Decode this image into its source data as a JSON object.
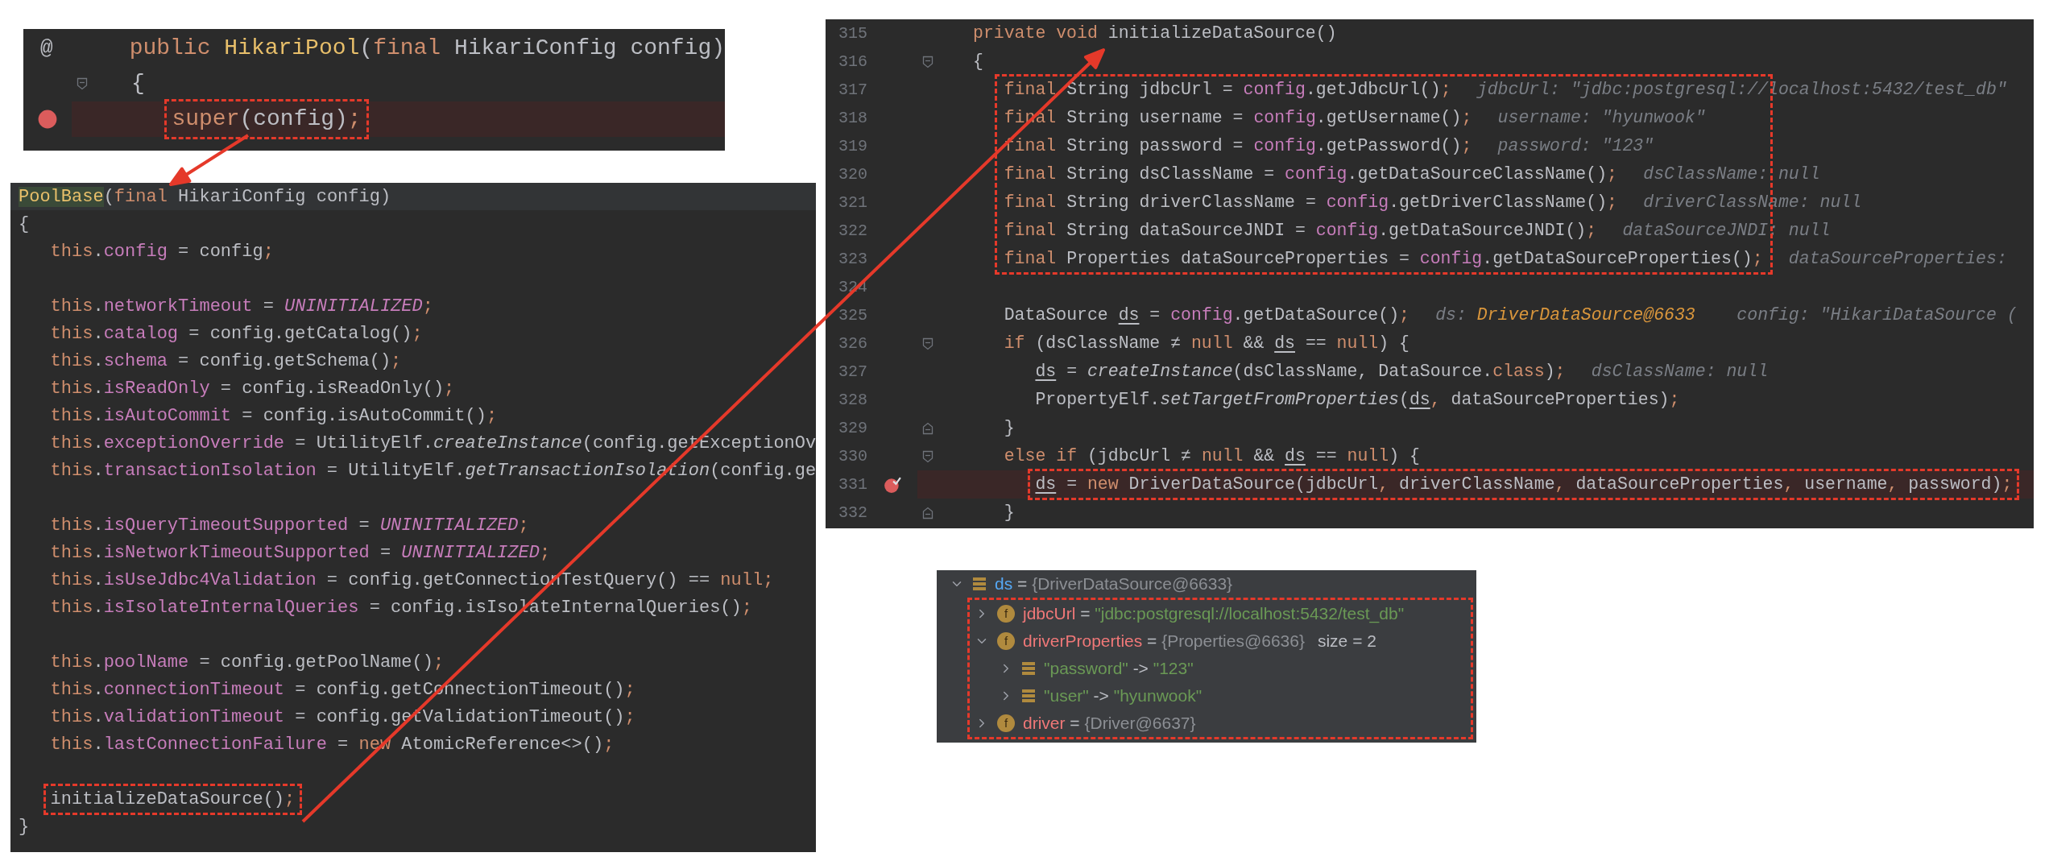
{
  "constructor_snippet": {
    "lines": [
      {
        "kind": "code",
        "gutter_mark": "@",
        "tokens": [
          {
            "kind": "keyword",
            "text": "public "
          },
          {
            "kind": "declaration",
            "text": "HikariPool"
          },
          {
            "kind": "plain",
            "text": "("
          },
          {
            "kind": "keyword",
            "text": "final"
          },
          {
            "kind": "plain",
            "text": " HikariConfig config)"
          }
        ]
      },
      {
        "kind": "code",
        "fold_start": true,
        "tokens": [
          {
            "kind": "plain",
            "text": "{"
          }
        ]
      },
      {
        "kind": "code",
        "breakpoint": true,
        "verified": false,
        "boxed": true,
        "tokens": [
          {
            "kind": "keyword",
            "text": "   super"
          },
          {
            "kind": "plain",
            "text": "(config)"
          },
          {
            "kind": "keyword",
            "text": ";"
          }
        ]
      }
    ]
  },
  "pool_base_snippet": {
    "lines": [
      {
        "kind": "code",
        "current": true,
        "tokens": [
          {
            "kind": "match",
            "text": "PoolBase"
          },
          {
            "kind": "plain",
            "text": "("
          },
          {
            "kind": "keyword",
            "text": "final"
          },
          {
            "kind": "plain",
            "text": " HikariConfig config)"
          }
        ]
      },
      {
        "kind": "code",
        "tokens": [
          {
            "kind": "plain",
            "text": "{"
          }
        ]
      },
      {
        "kind": "code",
        "tokens": [
          {
            "kind": "keyword",
            "text": "   this"
          },
          {
            "kind": "plain",
            "text": "."
          },
          {
            "kind": "field",
            "text": "config"
          },
          {
            "kind": "plain",
            "text": " = config"
          },
          {
            "kind": "keyword",
            "text": ";"
          }
        ]
      },
      {
        "kind": "blank"
      },
      {
        "kind": "code",
        "tokens": [
          {
            "kind": "keyword",
            "text": "   this"
          },
          {
            "kind": "plain",
            "text": "."
          },
          {
            "kind": "field",
            "text": "networkTimeout"
          },
          {
            "kind": "plain",
            "text": " = "
          },
          {
            "kind": "constant",
            "text": "UNINITIALIZED"
          },
          {
            "kind": "keyword",
            "text": ";"
          }
        ]
      },
      {
        "kind": "code",
        "tokens": [
          {
            "kind": "keyword",
            "text": "   this"
          },
          {
            "kind": "plain",
            "text": "."
          },
          {
            "kind": "field",
            "text": "catalog"
          },
          {
            "kind": "plain",
            "text": " = config.getCatalog()"
          },
          {
            "kind": "keyword",
            "text": ";"
          }
        ]
      },
      {
        "kind": "code",
        "tokens": [
          {
            "kind": "keyword",
            "text": "   this"
          },
          {
            "kind": "plain",
            "text": "."
          },
          {
            "kind": "field",
            "text": "schema"
          },
          {
            "kind": "plain",
            "text": " = config.getSchema()"
          },
          {
            "kind": "keyword",
            "text": ";"
          }
        ]
      },
      {
        "kind": "code",
        "tokens": [
          {
            "kind": "keyword",
            "text": "   this"
          },
          {
            "kind": "plain",
            "text": "."
          },
          {
            "kind": "field",
            "text": "isReadOnly"
          },
          {
            "kind": "plain",
            "text": " = config.isReadOnly()"
          },
          {
            "kind": "keyword",
            "text": ";"
          }
        ]
      },
      {
        "kind": "code",
        "tokens": [
          {
            "kind": "keyword",
            "text": "   this"
          },
          {
            "kind": "plain",
            "text": "."
          },
          {
            "kind": "field",
            "text": "isAutoCommit"
          },
          {
            "kind": "plain",
            "text": " = config.isAutoCommit()"
          },
          {
            "kind": "keyword",
            "text": ";"
          }
        ]
      },
      {
        "kind": "code",
        "tokens": [
          {
            "kind": "keyword",
            "text": "   this"
          },
          {
            "kind": "plain",
            "text": "."
          },
          {
            "kind": "field",
            "text": "exceptionOverride"
          },
          {
            "kind": "plain",
            "text": " = UtilityElf."
          },
          {
            "kind": "static",
            "text": "createInstance"
          },
          {
            "kind": "plain",
            "text": "(config.getExceptionOv"
          }
        ]
      },
      {
        "kind": "code",
        "tokens": [
          {
            "kind": "keyword",
            "text": "   this"
          },
          {
            "kind": "plain",
            "text": "."
          },
          {
            "kind": "field",
            "text": "transactionIsolation"
          },
          {
            "kind": "plain",
            "text": " = UtilityElf."
          },
          {
            "kind": "static",
            "text": "getTransactionIsolation"
          },
          {
            "kind": "plain",
            "text": "(config.ge"
          }
        ]
      },
      {
        "kind": "blank"
      },
      {
        "kind": "code",
        "tokens": [
          {
            "kind": "keyword",
            "text": "   this"
          },
          {
            "kind": "plain",
            "text": "."
          },
          {
            "kind": "field",
            "text": "isQueryTimeoutSupported"
          },
          {
            "kind": "plain",
            "text": " = "
          },
          {
            "kind": "constant",
            "text": "UNINITIALIZED"
          },
          {
            "kind": "keyword",
            "text": ";"
          }
        ]
      },
      {
        "kind": "code",
        "tokens": [
          {
            "kind": "keyword",
            "text": "   this"
          },
          {
            "kind": "plain",
            "text": "."
          },
          {
            "kind": "field",
            "text": "isNetworkTimeoutSupported"
          },
          {
            "kind": "plain",
            "text": " = "
          },
          {
            "kind": "constant",
            "text": "UNINITIALIZED"
          },
          {
            "kind": "keyword",
            "text": ";"
          }
        ]
      },
      {
        "kind": "code",
        "tokens": [
          {
            "kind": "keyword",
            "text": "   this"
          },
          {
            "kind": "plain",
            "text": "."
          },
          {
            "kind": "field",
            "text": "isUseJdbc4Validation"
          },
          {
            "kind": "plain",
            "text": " = config.getConnectionTestQuery() == "
          },
          {
            "kind": "keyword",
            "text": "null;"
          }
        ]
      },
      {
        "kind": "code",
        "tokens": [
          {
            "kind": "keyword",
            "text": "   this"
          },
          {
            "kind": "plain",
            "text": "."
          },
          {
            "kind": "field",
            "text": "isIsolateInternalQueries"
          },
          {
            "kind": "plain",
            "text": " = config.isIsolateInternalQueries()"
          },
          {
            "kind": "keyword",
            "text": ";"
          }
        ]
      },
      {
        "kind": "blank"
      },
      {
        "kind": "code",
        "tokens": [
          {
            "kind": "keyword",
            "text": "   this"
          },
          {
            "kind": "plain",
            "text": "."
          },
          {
            "kind": "field",
            "text": "poolName"
          },
          {
            "kind": "plain",
            "text": " = config.getPoolName()"
          },
          {
            "kind": "keyword",
            "text": ";"
          }
        ]
      },
      {
        "kind": "code",
        "tokens": [
          {
            "kind": "keyword",
            "text": "   this"
          },
          {
            "kind": "plain",
            "text": "."
          },
          {
            "kind": "field",
            "text": "connectionTimeout"
          },
          {
            "kind": "plain",
            "text": " = config.getConnectionTimeout()"
          },
          {
            "kind": "keyword",
            "text": ";"
          }
        ]
      },
      {
        "kind": "code",
        "tokens": [
          {
            "kind": "keyword",
            "text": "   this"
          },
          {
            "kind": "plain",
            "text": "."
          },
          {
            "kind": "field",
            "text": "validationTimeout"
          },
          {
            "kind": "plain",
            "text": " = config.getValidationTimeout()"
          },
          {
            "kind": "keyword",
            "text": ";"
          }
        ]
      },
      {
        "kind": "code",
        "tokens": [
          {
            "kind": "keyword",
            "text": "   this"
          },
          {
            "kind": "plain",
            "text": "."
          },
          {
            "kind": "field",
            "text": "lastConnectionFailure"
          },
          {
            "kind": "plain",
            "text": " = "
          },
          {
            "kind": "keyword",
            "text": "new"
          },
          {
            "kind": "plain",
            "text": " AtomicReference<>()"
          },
          {
            "kind": "keyword",
            "text": ";"
          }
        ]
      },
      {
        "kind": "blank"
      },
      {
        "kind": "code",
        "boxed": true,
        "tokens": [
          {
            "kind": "plain",
            "text": "   initializeDataSource()"
          },
          {
            "kind": "keyword",
            "text": ";"
          }
        ]
      },
      {
        "kind": "code",
        "tokens": [
          {
            "kind": "plain",
            "text": "}"
          }
        ]
      }
    ]
  },
  "initialize_snippet": {
    "lines": [
      {
        "kind": "code",
        "number": "315",
        "tokens": [
          {
            "kind": "keyword",
            "text": "private void "
          },
          {
            "kind": "plain",
            "text": "initializeDataSource()"
          }
        ]
      },
      {
        "kind": "code",
        "number": "316",
        "fold_start": true,
        "tokens": [
          {
            "kind": "plain",
            "text": "{"
          }
        ]
      },
      {
        "kind": "boxed_group",
        "boxed": true,
        "lines": [
          {
            "kind": "code",
            "number": "317",
            "tokens": [
              {
                "kind": "keyword",
                "text": "   final"
              },
              {
                "kind": "plain",
                "text": " String jdbcUrl = "
              },
              {
                "kind": "field",
                "text": "config"
              },
              {
                "kind": "plain",
                "text": ".getJdbcUrl()"
              },
              {
                "kind": "keyword",
                "text": ";"
              }
            ],
            "hints": [
              {
                "label": "jdbcUrl:",
                "value": "\"jdbc:postgresql://localhost:5432/test_db\"",
                "object": false
              }
            ]
          },
          {
            "kind": "code",
            "number": "318",
            "tokens": [
              {
                "kind": "keyword",
                "text": "   final"
              },
              {
                "kind": "plain",
                "text": " String username = "
              },
              {
                "kind": "field",
                "text": "config"
              },
              {
                "kind": "plain",
                "text": ".getUsername()"
              },
              {
                "kind": "keyword",
                "text": ";"
              }
            ],
            "hints": [
              {
                "label": "username:",
                "value": "\"hyunwook\"",
                "object": false
              }
            ]
          },
          {
            "kind": "code",
            "number": "319",
            "tokens": [
              {
                "kind": "keyword",
                "text": "   final"
              },
              {
                "kind": "plain",
                "text": " String password = "
              },
              {
                "kind": "field",
                "text": "config"
              },
              {
                "kind": "plain",
                "text": ".getPassword()"
              },
              {
                "kind": "keyword",
                "text": ";"
              }
            ],
            "hints": [
              {
                "label": "password:",
                "value": "\"123\"",
                "object": false
              }
            ]
          },
          {
            "kind": "code",
            "number": "320",
            "tokens": [
              {
                "kind": "keyword",
                "text": "   final"
              },
              {
                "kind": "plain",
                "text": " String dsClassName = "
              },
              {
                "kind": "field",
                "text": "config"
              },
              {
                "kind": "plain",
                "text": ".getDataSourceClassName()"
              },
              {
                "kind": "keyword",
                "text": ";"
              }
            ],
            "hints": [
              {
                "label": "dsClassName:",
                "value": "null",
                "object": false
              }
            ]
          },
          {
            "kind": "code",
            "number": "321",
            "tokens": [
              {
                "kind": "keyword",
                "text": "   final"
              },
              {
                "kind": "plain",
                "text": " String driverClassName = "
              },
              {
                "kind": "field",
                "text": "config"
              },
              {
                "kind": "plain",
                "text": ".getDriverClassName()"
              },
              {
                "kind": "keyword",
                "text": ";"
              }
            ],
            "hints": [
              {
                "label": "driverClassName:",
                "value": "null",
                "object": false
              }
            ]
          },
          {
            "kind": "code",
            "number": "322",
            "tokens": [
              {
                "kind": "keyword",
                "text": "   final"
              },
              {
                "kind": "plain",
                "text": " String dataSourceJNDI = "
              },
              {
                "kind": "field",
                "text": "config"
              },
              {
                "kind": "plain",
                "text": ".getDataSourceJNDI()"
              },
              {
                "kind": "keyword",
                "text": ";"
              }
            ],
            "hints": [
              {
                "label": "dataSourceJNDI:",
                "value": "null",
                "object": false
              }
            ]
          },
          {
            "kind": "code",
            "number": "323",
            "tokens": [
              {
                "kind": "keyword",
                "text": "   final"
              },
              {
                "kind": "plain",
                "text": " Properties dataSourceProperties = "
              },
              {
                "kind": "field",
                "text": "config"
              },
              {
                "kind": "plain",
                "text": ".getDataSourceProperties()"
              },
              {
                "kind": "keyword",
                "text": ";"
              }
            ],
            "hints": [
              {
                "label": "dataSourceProperties:"
              }
            ]
          }
        ]
      },
      {
        "kind": "blank",
        "number": "324"
      },
      {
        "kind": "code",
        "number": "325",
        "tokens": [
          {
            "kind": "plain",
            "text": "   DataSource "
          },
          {
            "kind": "reassigned",
            "text": "ds"
          },
          {
            "kind": "plain",
            "text": " = "
          },
          {
            "kind": "field",
            "text": "config"
          },
          {
            "kind": "plain",
            "text": ".getDataSource()"
          },
          {
            "kind": "keyword",
            "text": ";"
          }
        ],
        "hints": [
          {
            "label": "ds:",
            "value": "DriverDataSource@6633",
            "object": true
          },
          {
            "label": "config:",
            "value": "\"HikariDataSource (",
            "object": false
          }
        ]
      },
      {
        "kind": "code",
        "number": "326",
        "fold_start": true,
        "tokens": [
          {
            "kind": "keyword",
            "text": "   if"
          },
          {
            "kind": "plain",
            "text": " (dsClassName ≠ "
          },
          {
            "kind": "keyword",
            "text": "null"
          },
          {
            "kind": "plain",
            "text": " && "
          },
          {
            "kind": "reassigned",
            "text": "ds"
          },
          {
            "kind": "plain",
            "text": " == "
          },
          {
            "kind": "keyword",
            "text": "null"
          },
          {
            "kind": "plain",
            "text": ") {"
          }
        ]
      },
      {
        "kind": "code",
        "number": "327",
        "tokens": [
          {
            "kind": "reassigned",
            "text": "      ds"
          },
          {
            "kind": "plain",
            "text": " = "
          },
          {
            "kind": "static",
            "text": "createInstance"
          },
          {
            "kind": "plain",
            "text": "(dsClassName, DataSource."
          },
          {
            "kind": "keyword",
            "text": "class"
          },
          {
            "kind": "plain",
            "text": ")"
          },
          {
            "kind": "keyword",
            "text": ";"
          }
        ],
        "hints": [
          {
            "label": "dsClassName:",
            "value": "null",
            "object": false
          }
        ]
      },
      {
        "kind": "code",
        "number": "328",
        "tokens": [
          {
            "kind": "plain",
            "text": "      PropertyElf."
          },
          {
            "kind": "static",
            "text": "setTargetFromProperties"
          },
          {
            "kind": "plain",
            "text": "("
          },
          {
            "kind": "reassigned",
            "text": "ds"
          },
          {
            "kind": "keyword",
            "text": ","
          },
          {
            "kind": "plain",
            "text": " dataSourceProperties)"
          },
          {
            "kind": "keyword",
            "text": ";"
          }
        ]
      },
      {
        "kind": "code",
        "number": "329",
        "fold_end": true,
        "tokens": [
          {
            "kind": "plain",
            "text": "   }"
          }
        ]
      },
      {
        "kind": "code",
        "number": "330",
        "fold_start": true,
        "tokens": [
          {
            "kind": "keyword",
            "text": "   else if"
          },
          {
            "kind": "plain",
            "text": " (jdbcUrl ≠ "
          },
          {
            "kind": "keyword",
            "text": "null"
          },
          {
            "kind": "plain",
            "text": " && "
          },
          {
            "kind": "reassigned",
            "text": "ds"
          },
          {
            "kind": "plain",
            "text": " == "
          },
          {
            "kind": "keyword",
            "text": "null"
          },
          {
            "kind": "plain",
            "text": ") {"
          }
        ]
      },
      {
        "kind": "code",
        "number": "331",
        "breakpoint": true,
        "verified": true,
        "boxed": true,
        "tokens": [
          {
            "kind": "reassigned",
            "text": "      ds"
          },
          {
            "kind": "plain",
            "text": " = "
          },
          {
            "kind": "keyword",
            "text": "new"
          },
          {
            "kind": "plain",
            "text": " DriverDataSource(jdbcUrl"
          },
          {
            "kind": "keyword",
            "text": ","
          },
          {
            "kind": "plain",
            "text": " driverClassName"
          },
          {
            "kind": "keyword",
            "text": ","
          },
          {
            "kind": "plain",
            "text": " dataSourceProperties"
          },
          {
            "kind": "keyword",
            "text": ","
          },
          {
            "kind": "plain",
            "text": " username"
          },
          {
            "kind": "keyword",
            "text": ","
          },
          {
            "kind": "plain",
            "text": " password)"
          },
          {
            "kind": "keyword",
            "text": ";"
          }
        ]
      },
      {
        "kind": "code",
        "number": "332",
        "fold_end": true,
        "tokens": [
          {
            "kind": "plain",
            "text": "   }"
          }
        ]
      }
    ]
  },
  "debugger_variables": {
    "tree": [
      {
        "name": "ds",
        "kind": "variable",
        "separator": "=",
        "value": "{DriverDataSource@6633}",
        "string_value": false,
        "expanded": true,
        "children_boxed": true,
        "children": [
          {
            "name": "jdbcUrl",
            "kind": "field",
            "badge": "f",
            "separator": "=",
            "value": "\"jdbc:postgresql://localhost:5432/test_db\"",
            "string_value": true,
            "expanded": false
          },
          {
            "name": "driverProperties",
            "kind": "field",
            "badge": "f",
            "separator": "=",
            "value": "{Properties@6636}",
            "string_value": false,
            "extra": "size = 2",
            "expanded": true,
            "children": [
              {
                "name": "\"password\"",
                "kind": "entry",
                "separator": "->",
                "value": "\"123\"",
                "string_value": true,
                "expanded": false
              },
              {
                "name": "\"user\"",
                "kind": "entry",
                "separator": "->",
                "value": "\"hyunwook\"",
                "string_value": true,
                "expanded": false
              }
            ]
          },
          {
            "name": "driver",
            "kind": "field",
            "badge": "f",
            "separator": "=",
            "value": "{Driver@6637}",
            "string_value": false,
            "expanded": false
          }
        ]
      }
    ]
  }
}
